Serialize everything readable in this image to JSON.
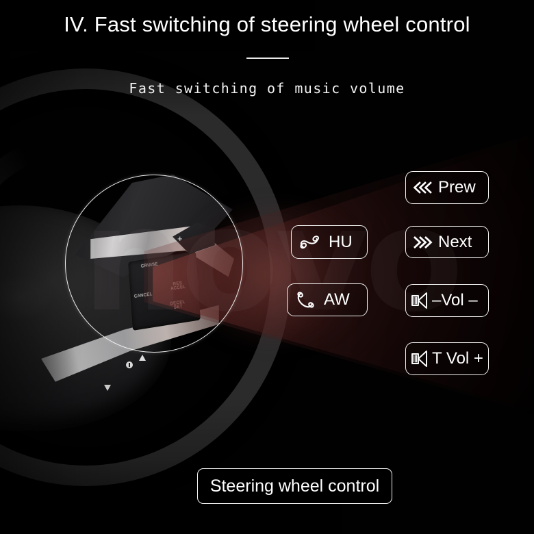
{
  "page": {
    "title": "IV. Fast switching of steering wheel control",
    "subtitle": "Fast switching of music volume",
    "watermark": "novo",
    "accent_color": "#8a3c36",
    "background_color": "#010101",
    "text_color": "#ffffff"
  },
  "callouts": [
    {
      "id": "prew",
      "icon": "chevrons-left-icon",
      "label": "Prew"
    },
    {
      "id": "next",
      "icon": "chevrons-right-icon",
      "label": "Next"
    },
    {
      "id": "hu",
      "icon": "phone-hangup-icon",
      "label": "HU"
    },
    {
      "id": "aw",
      "icon": "phone-answer-icon",
      "label": "AW"
    },
    {
      "id": "vdn",
      "icon": "speaker-icon",
      "label": "–Vol –"
    },
    {
      "id": "vup",
      "icon": "speaker-icon",
      "label": "T Vol +"
    }
  ],
  "footer": {
    "label": "Steering wheel control"
  },
  "steering_wheel": {
    "buttons": [
      {
        "label": "CRUISE"
      },
      {
        "label": "CANCEL"
      },
      {
        "label_line1": "RES",
        "label_line2": "ACCEL"
      },
      {
        "label_line1": "DECEL",
        "label_line2": "SET"
      }
    ],
    "paddle_glyph": "+"
  }
}
